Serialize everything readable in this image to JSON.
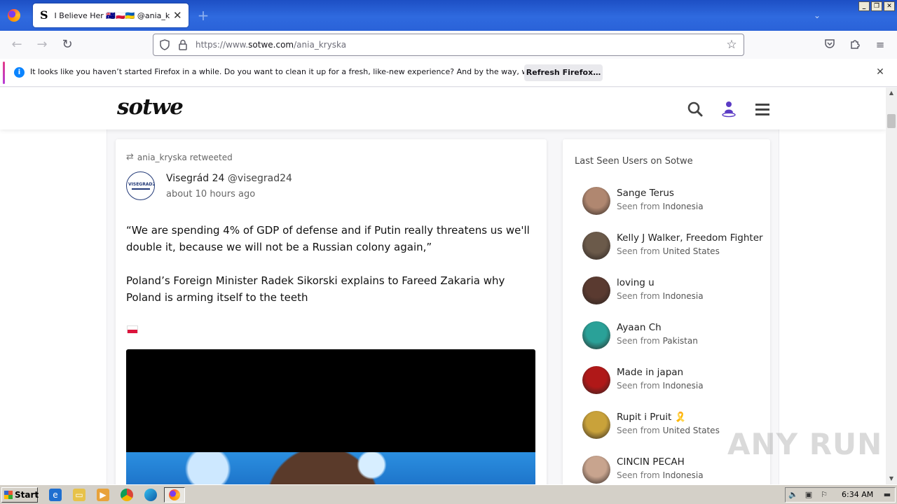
{
  "browser": {
    "tab_title": "I Believe Her 🇦🇺🇵🇱🇺🇦 @ania_kryska",
    "tab_favicon": "S",
    "url_prefix": "https://www.",
    "url_domain": "sotwe.com",
    "url_path": "/ania_kryska",
    "icons": [
      "firefox-icon",
      "back-icon",
      "forward-icon",
      "reload-icon",
      "shield-icon",
      "lock-icon",
      "bookmark-star-icon",
      "pocket-icon",
      "extensions-icon",
      "hamburger-menu-icon"
    ]
  },
  "notification": {
    "message": "It looks like you haven’t started Firefox in a while. Do you want to clean it up for a fresh, like-new experience? And by the way, welcome back!",
    "button": "Refresh Firefox…",
    "info_glyph": "i"
  },
  "site": {
    "logo": "sotwe"
  },
  "tweet": {
    "retweet_by": "ania_kryska retweeted",
    "author_name": "Visegrád 24",
    "author_handle": "@visegrad24",
    "avatar_text": "VISEGRAD24",
    "time": "about 10 hours ago",
    "paragraph1": "“We are spending 4% of GDP of defense and if Putin really threatens us we'll double it, because we will not be a Russian colony again,”",
    "paragraph2": "Poland’s Foreign Minister Radek Sikorski explains to Fareed Zakaria why Poland is arming itself to the teeth"
  },
  "sidebar": {
    "title": "Last Seen Users on Sotwe",
    "seen_prefix": "Seen from",
    "users": [
      {
        "name": "Sange Terus",
        "country": "Indonesia",
        "color": "#b08770"
      },
      {
        "name": "Kelly J Walker, Freedom Fighter",
        "country": "United States",
        "color": "#6b5a4a"
      },
      {
        "name": "loving u",
        "country": "Indonesia",
        "color": "#5a3a30"
      },
      {
        "name": "Ayaan Ch",
        "country": "Pakistan",
        "color": "#2aa198"
      },
      {
        "name": "Made in japan",
        "country": "Indonesia",
        "color": "#b01818"
      },
      {
        "name": "Rupit i Pruit 🎗️",
        "country": "United States",
        "color": "#c9a23a"
      },
      {
        "name": "CINCIN PECAH",
        "country": "Indonesia",
        "color": "#c8a48e"
      }
    ]
  },
  "watermark": "ANY RUN",
  "taskbar": {
    "start_label": "Start",
    "clock": "6:34 AM"
  }
}
